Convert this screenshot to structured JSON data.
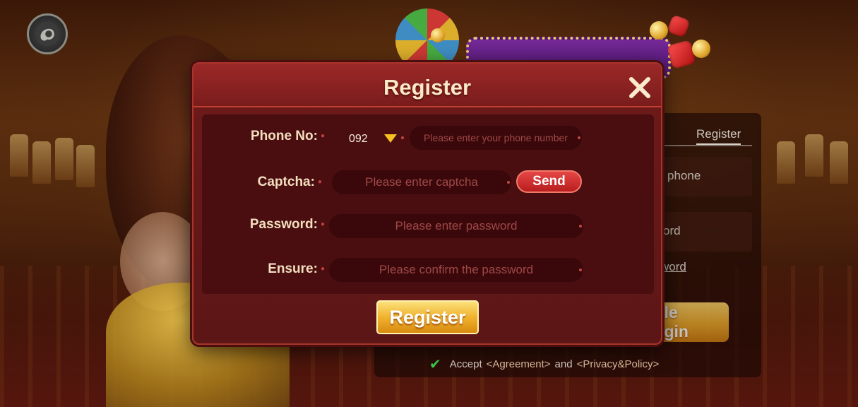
{
  "background": {
    "login_panel": {
      "tab_register": "Register",
      "phone_hint": "phone",
      "password_hint": "ord",
      "forgot_link": "word",
      "mobile_login_button": "bile login",
      "accept": {
        "label": "Accept",
        "agreement_link": "<Agreement>",
        "and": "and",
        "privacy_link": "<Privacy&Policy>"
      }
    }
  },
  "modal": {
    "title": "Register",
    "fields": {
      "phone": {
        "label": "Phone No:",
        "country_code": "092",
        "placeholder": "Please enter your phone number"
      },
      "captcha": {
        "label": "Captcha:",
        "placeholder": "Please enter captcha",
        "send_label": "Send"
      },
      "password": {
        "label": "Password:",
        "placeholder": "Please enter password"
      },
      "ensure": {
        "label": "Ensure:",
        "placeholder": "Please confirm the password"
      }
    },
    "submit_label": "Register"
  },
  "icons": {
    "avatar": "avatar-icon",
    "close": "close-icon",
    "dropdown": "triangle-down-icon",
    "check": "check-icon"
  },
  "colors": {
    "modal_bg": "#5c1616",
    "title": "#fbe9c8",
    "send_button": "#d42c2c",
    "register_button": "#f0b32e",
    "check": "#3fd24a"
  }
}
